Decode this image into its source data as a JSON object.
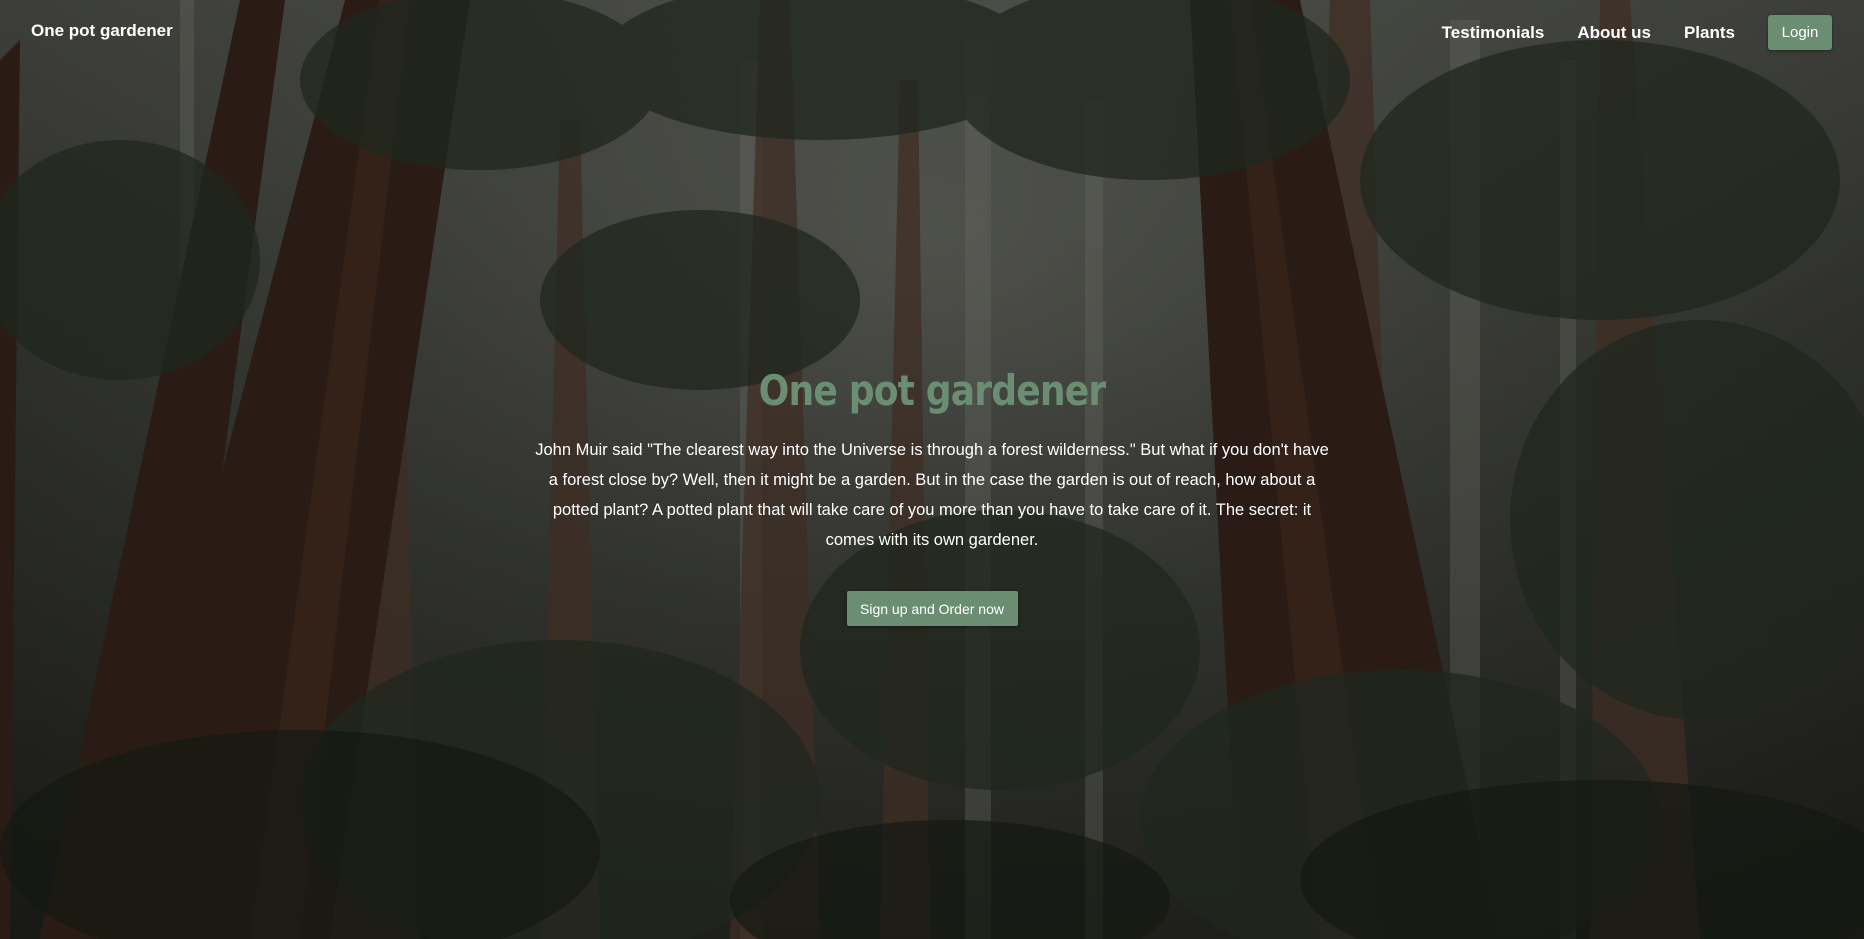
{
  "navbar": {
    "brand": "One pot gardener",
    "links": [
      {
        "label": "Testimonials"
      },
      {
        "label": "About us"
      },
      {
        "label": "Plants"
      }
    ],
    "login_label": "Login"
  },
  "hero": {
    "title": "One pot gardener",
    "text": "John Muir said \"The clearest way into the Universe is through a forest wilderness.\" But what if you don't have a forest close by? Well, then it might be a garden. But in the case the garden is out of reach, how about a potted plant? A potted plant that will take care of you more than you have to take care of it. The secret: it comes with its own gardener.",
    "cta_label": "Sign up and Order now"
  },
  "colors": {
    "accent": "#6b8e72",
    "nav_text": "#ffffff",
    "body_text": "#ffffff"
  }
}
